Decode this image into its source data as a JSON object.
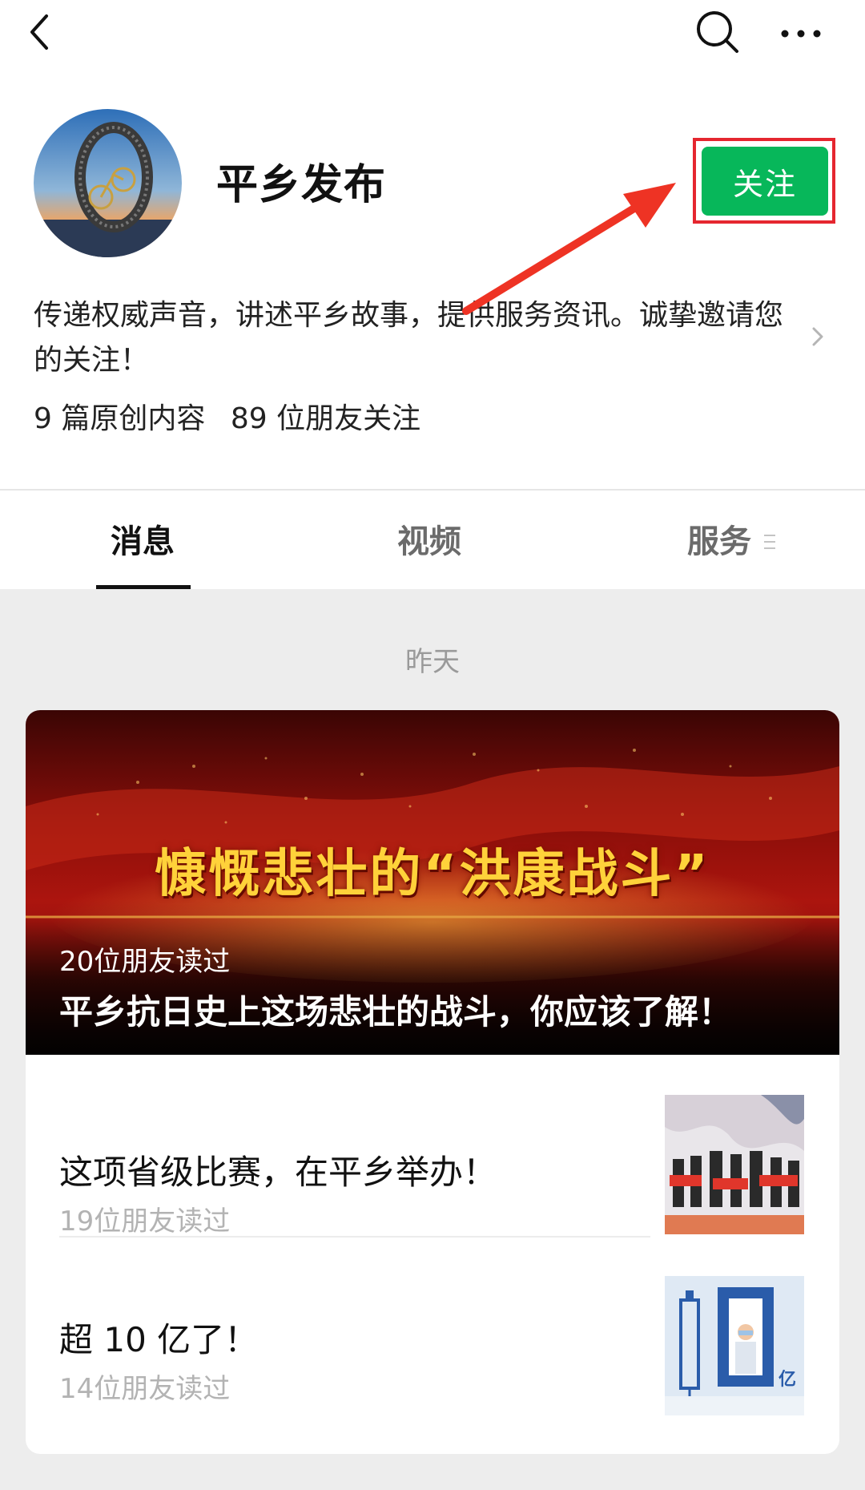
{
  "profile": {
    "name": "平乡发布",
    "follow_label": "关注",
    "description": "传递权威声音，讲述平乡故事，提供服务资讯。诚挚邀请您的关注！",
    "stats": {
      "original_count": "9 篇原创内容",
      "followers": "89 位朋友关注"
    }
  },
  "tabs": [
    {
      "label": "消息",
      "active": true
    },
    {
      "label": "视频",
      "active": false
    },
    {
      "label": "服务",
      "active": false
    }
  ],
  "feed": {
    "date_label": "昨天",
    "featured": {
      "headline": "慷慨悲壮的“洪康战斗”",
      "readers": "20位朋友读过",
      "title": "平乡抗日史上这场悲壮的战斗，你应该了解！"
    },
    "items": [
      {
        "title": "这项省级比赛，在平乡举办！",
        "readers": "19位朋友读过"
      },
      {
        "title": "超 10 亿了！",
        "readers": "14位朋友读过"
      }
    ],
    "thumb2_label": "亿"
  },
  "icons": {
    "back": "chevron-left-icon",
    "search": "search-icon",
    "more": "more-icon",
    "chevron": "chevron-right-icon",
    "menu": "menu-icon"
  },
  "colors": {
    "follow_button": "#07b75a",
    "highlight_border": "#e5262f",
    "annotation_arrow": "#ee3324",
    "feed_background": "#ededed"
  }
}
